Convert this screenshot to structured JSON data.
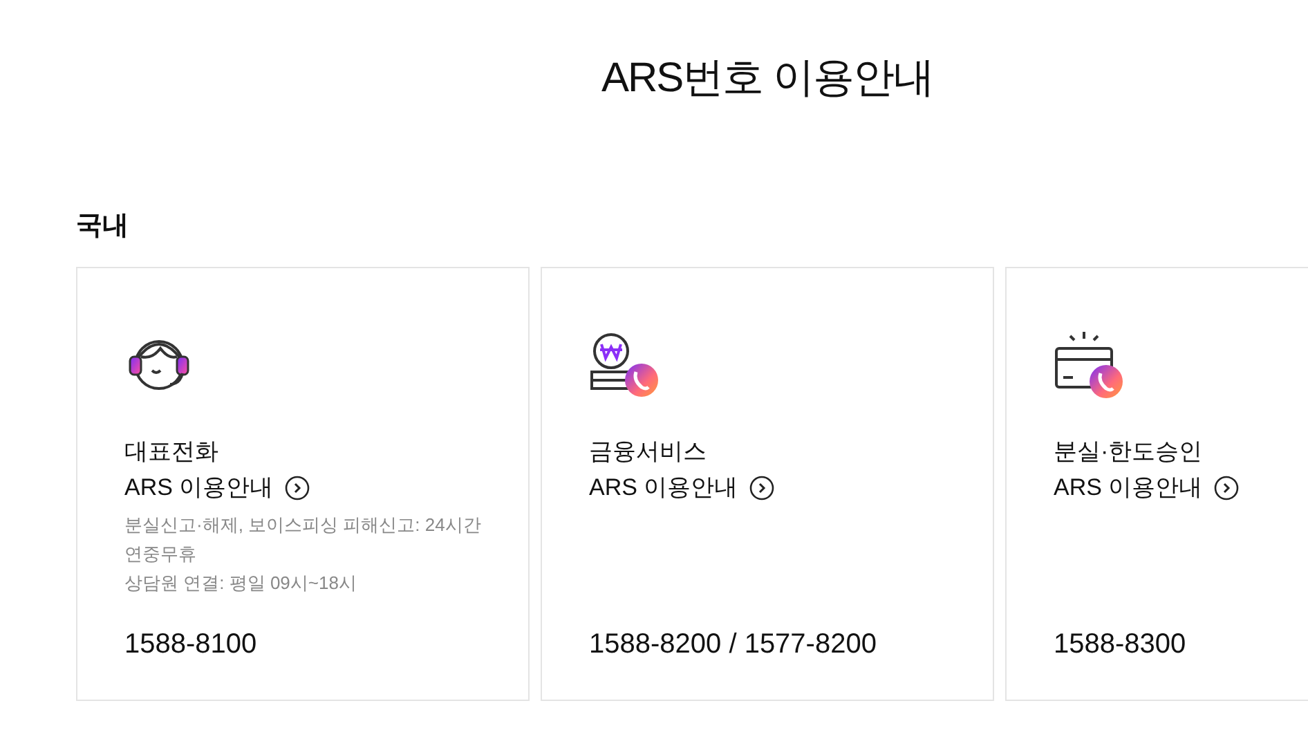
{
  "page_title": "ARS번호 이용안내",
  "section": {
    "title": "국내",
    "cards": [
      {
        "kind": "headset",
        "title": "대표전화",
        "link": "ARS 이용안내",
        "notes": [
          "분실신고·해제, 보이스피싱 피해신고: 24시간 연중무휴",
          "상담원 연결: 평일 09시~18시"
        ],
        "phone": "1588-8100"
      },
      {
        "kind": "coin",
        "title": "금융서비스",
        "link": "ARS 이용안내",
        "phone": "1588-8200 / 1577-8200"
      },
      {
        "kind": "card",
        "title": "분실·한도승인",
        "link": "ARS 이용안내",
        "phone": "1588-8300"
      }
    ]
  }
}
